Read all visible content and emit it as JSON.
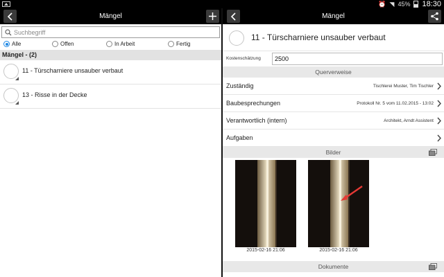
{
  "status_bar": {
    "battery": "45%",
    "time": "18:30",
    "icons": [
      "image-icon",
      "clock-icon",
      "wifi-icon",
      "battery-icon"
    ]
  },
  "left": {
    "title": "Mängel",
    "search_placeholder": "Suchbegriff",
    "filters": [
      {
        "label": "Alle",
        "selected": true
      },
      {
        "label": "Offen",
        "selected": false
      },
      {
        "label": "In Arbeit",
        "selected": false
      },
      {
        "label": "Fertig",
        "selected": false
      }
    ],
    "section": "Mängel - (2)",
    "items": [
      {
        "label": "11 - Türscharniere unsauber verbaut"
      },
      {
        "label": "13 - Risse in der Decke"
      }
    ]
  },
  "right": {
    "title": "Mängel",
    "detail_title": "11 - Türscharniere unsauber verbaut",
    "cost_label": "Kostenschätzung",
    "cost_value": "2500",
    "section_cross": "Querverweise",
    "rows": [
      {
        "label": "Zuständig",
        "value": "Tischlerei Muster, Tim Tischler"
      },
      {
        "label": "Baubesprechungen",
        "value": "Protokoll Nr. 5 vom 11.02.2015 - 13:02"
      },
      {
        "label": "Verantwortlich (intern)",
        "value": "Architekt, Arndt Assistent"
      },
      {
        "label": "Aufgaben",
        "value": ""
      }
    ],
    "section_images": "Bilder",
    "images": [
      {
        "caption": "2015-02-16 21:06"
      },
      {
        "caption": "2015-02-16 21:06"
      }
    ],
    "section_docs": "Dokumente"
  },
  "colors": {
    "accent": "#1e88e5",
    "header_bg": "#000000",
    "section_bg": "#e2e2e2",
    "arrow": "#e53935"
  }
}
